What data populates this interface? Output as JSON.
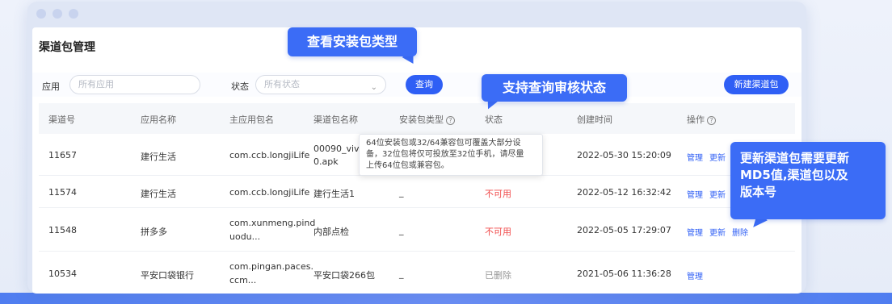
{
  "page_title": "渠道包管理",
  "filters": {
    "app_label": "应用",
    "app_placeholder": "所有应用",
    "status_label": "状态",
    "status_placeholder": "所有状态",
    "query_button": "查询",
    "new_button": "新建渠道包"
  },
  "table": {
    "headers": [
      "渠道号",
      "应用名称",
      "主应用包名",
      "渠道包名称",
      "安装包类型",
      "状态",
      "创建时间",
      "操作"
    ],
    "rows": [
      {
        "channel": "11657",
        "app": "建行生活",
        "pkg": "com.ccb.longjiLife",
        "name_l1": "00090_vivo",
        "name_l2": "0.apk",
        "type": "",
        "status": "",
        "time": "2022-05-30 15:20:09",
        "ops": [
          "管理",
          "更新"
        ]
      },
      {
        "channel": "11574",
        "app": "建行生活",
        "pkg": "com.ccb.longjiLife",
        "name_l1": "建行生活1",
        "name_l2": "",
        "type": "_",
        "status": "不可用",
        "time": "2022-05-12 16:32:42",
        "ops": [
          "管理",
          "更新"
        ]
      },
      {
        "channel": "11548",
        "app": "拼多多",
        "pkg_l1": "com.xunmeng.pind",
        "pkg_l2": "uodu...",
        "name_l1": "内部点检",
        "name_l2": "",
        "type": "_",
        "status": "不可用",
        "time": "2022-05-05 17:29:07",
        "ops": [
          "管理",
          "更新",
          "删除"
        ]
      },
      {
        "channel": "10534",
        "app": "平安口袋银行",
        "pkg_l1": "com.pingan.paces.",
        "pkg_l2": "ccm...",
        "name_l1": "平安口袋266包",
        "name_l2": "",
        "type": "_",
        "status": "已删除",
        "time": "2021-05-06 11:36:28",
        "ops": [
          "管理"
        ]
      }
    ]
  },
  "tooltip": {
    "line1": "64位安装包或32/64兼容包可覆盖大部分设",
    "line2": "备，32位包将仅可投放至32位手机，请尽量",
    "line3": "上传64位包或兼容包。"
  },
  "callouts": {
    "c1": "查看安装包类型",
    "c2": "支持查询审核状态",
    "c3_l1": "更新渠道包需要更新",
    "c3_l2": "MD5值,渠道包以及",
    "c3_l3": "版本号"
  },
  "colors": {
    "accent": "#2f5ff5",
    "callout": "#3b6cf6",
    "danger": "#f04a4a"
  }
}
